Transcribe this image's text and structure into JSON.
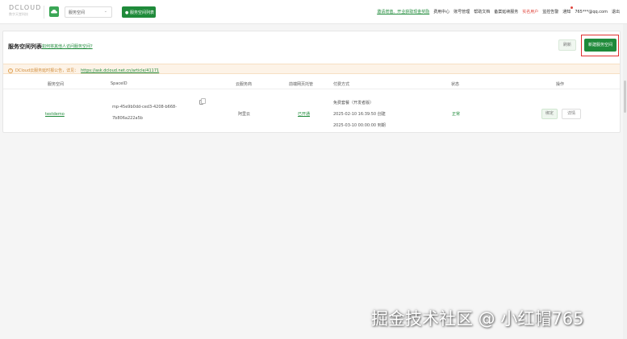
{
  "logo": {
    "text": "DCLOUD",
    "sub": "数字天堂科技"
  },
  "topbar": {
    "space_select": "服务空间",
    "space_list_button": "● 服务空间列表",
    "nav": [
      {
        "label": "邀请增值、开业获取现金奖励",
        "style": "green"
      },
      {
        "label": "费用中心",
        "style": "normal"
      },
      {
        "label": "账号管理",
        "style": "normal"
      },
      {
        "label": "帮助文档",
        "style": "normal"
      },
      {
        "label": "备案延续服务",
        "style": "normal"
      },
      {
        "label": "实名用户",
        "style": "red"
      },
      {
        "label": "监控告警",
        "style": "normal"
      },
      {
        "label": "通知",
        "style": "normal"
      },
      {
        "label": "765***@qq.com",
        "style": "normal"
      },
      {
        "label": "退出",
        "style": "normal"
      }
    ]
  },
  "card": {
    "title": "服务空间列表",
    "help_link": "如何将其他人访问服务空间?",
    "refresh_button": "刷新",
    "new_button": "新建服务空间",
    "notice": {
      "text": "DCloud云服务延时报公告，详见：",
      "url": "https://ask.dcloud.net.cn/article/41171"
    },
    "columns": [
      "服务空间",
      "SpaceID",
      "云服务商",
      "前端网页托管",
      "付费方式",
      "状态",
      "操作"
    ],
    "rows": [
      {
        "name": "testdemo",
        "space_id_line1": "mp-45e9b0dd-ced3-4208-b668-",
        "space_id_line2": "7b806a222a5b",
        "provider": "阿里云",
        "hosting": "已开通",
        "billing_line1": "免费套餐（开发者版）",
        "billing_line2": "2025-02-10 16:39:50 创建",
        "billing_line3": "2025-03-10 00:00:00 到期",
        "status": "正常",
        "bind_button": "绑定",
        "detail_button": "详情"
      }
    ]
  },
  "watermark": "掘金技术社区 @ 小红帽765",
  "colors": {
    "accent": "#1f8a3a",
    "danger": "#e03030",
    "notice_bg": "#fdf3e7"
  }
}
